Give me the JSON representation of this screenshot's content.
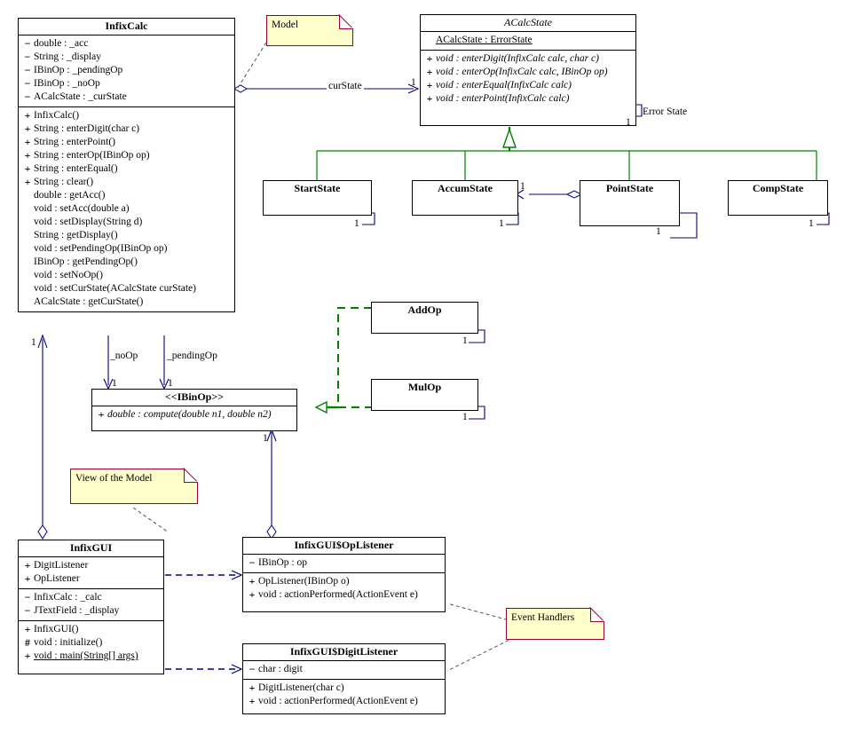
{
  "diagram": {
    "title": "InfixCalc UML class diagram",
    "colors": {
      "association": "#000080",
      "generalization": "#008000",
      "note_border": "#99003a",
      "note_fill": "#ffffcc",
      "box_border": "#000000",
      "background": "#ffffff"
    }
  },
  "classes": {
    "infixcalc": {
      "name": "InfixCalc",
      "fields": [
        {
          "vis": "−",
          "text": "double : _acc"
        },
        {
          "vis": "−",
          "text": "String : _display"
        },
        {
          "vis": "−",
          "text": "IBinOp : _pendingOp"
        },
        {
          "vis": "−",
          "text": "IBinOp : _noOp"
        },
        {
          "vis": "−",
          "text": "ACalcState : _curState"
        }
      ],
      "methods": [
        {
          "vis": "+",
          "text": "InfixCalc()"
        },
        {
          "vis": "+",
          "text": "String : enterDigit(char c)"
        },
        {
          "vis": "+",
          "text": "String : enterPoint()"
        },
        {
          "vis": "+",
          "text": "String : enterOp(IBinOp op)"
        },
        {
          "vis": "+",
          "text": "String : enterEqual()"
        },
        {
          "vis": "+",
          "text": "String : clear()"
        },
        {
          "vis": "",
          "text": "double : getAcc()"
        },
        {
          "vis": "",
          "text": "void : setAcc(double a)"
        },
        {
          "vis": "",
          "text": "void : setDisplay(String d)"
        },
        {
          "vis": "",
          "text": "String : getDisplay()"
        },
        {
          "vis": "",
          "text": "void : setPendingOp(IBinOp op)"
        },
        {
          "vis": "",
          "text": "IBinOp : getPendingOp()"
        },
        {
          "vis": "",
          "text": "void : setNoOp()"
        },
        {
          "vis": "",
          "text": "void : setCurState(ACalcState curState)"
        },
        {
          "vis": "",
          "text": "ACalcState : getCurState()"
        }
      ]
    },
    "acalcstate": {
      "name": "ACalcState",
      "abstract": true,
      "fields": [
        {
          "vis": "",
          "text": "ACalcState : ErrorState",
          "underline": true
        }
      ],
      "methods": [
        {
          "vis": "+",
          "text": "void : enterDigit(InfixCalc calc, char c)"
        },
        {
          "vis": "+",
          "text": "void : enterOp(InfixCalc calc, IBinOp op)"
        },
        {
          "vis": "+",
          "text": "void : enterEqual(InfixCalc calc)"
        },
        {
          "vis": "+",
          "text": "void : enterPoint(InfixCalc calc)"
        }
      ]
    },
    "startstate": {
      "name": "StartState",
      "mult": "1"
    },
    "accumstate": {
      "name": "AccumState",
      "mult": "1"
    },
    "pointstate": {
      "name": "PointState",
      "mult": "1"
    },
    "compstate": {
      "name": "CompState",
      "mult": "1"
    },
    "addop": {
      "name": "AddOp",
      "mult": "1"
    },
    "mulop": {
      "name": "MulOp",
      "mult": "1"
    },
    "ibinop": {
      "name": "<<IBinOp>>",
      "name_pre": "<<",
      "name_core": "IBinOp",
      "name_post": ">>",
      "methods": [
        {
          "vis": "+",
          "text": "double : compute(double n1, double n2)",
          "italic": true
        }
      ],
      "mult": "1"
    },
    "infixgui": {
      "name": "InfixGUI",
      "nested": [
        {
          "vis": "+",
          "text": "DigitListener"
        },
        {
          "vis": "+",
          "text": "OpListener"
        }
      ],
      "fields": [
        {
          "vis": "−",
          "text": "InfixCalc : _calc"
        },
        {
          "vis": "−",
          "text": "JTextField : _display"
        }
      ],
      "methods": [
        {
          "vis": "+",
          "text": "InfixGUI()"
        },
        {
          "vis": "#",
          "text": "void : initialize()"
        },
        {
          "vis": "+",
          "text": "void : main(String[] args)",
          "underline": true
        }
      ]
    },
    "oplistener": {
      "name": "InfixGUI$OpListener",
      "fields": [
        {
          "vis": "−",
          "text": "IBinOp : op"
        }
      ],
      "methods": [
        {
          "vis": "+",
          "text": "OpListener(IBinOp o)"
        },
        {
          "vis": "+",
          "text": "void : actionPerformed(ActionEvent e)"
        }
      ]
    },
    "digitlistener": {
      "name": "InfixGUI$DigitListener",
      "fields": [
        {
          "vis": "−",
          "text": "char : digit"
        }
      ],
      "methods": [
        {
          "vis": "+",
          "text": "DigitListener(char c)"
        },
        {
          "vis": "+",
          "text": "void : actionPerformed(ActionEvent e)"
        }
      ]
    }
  },
  "notes": [
    {
      "id": "model",
      "text": "Model"
    },
    {
      "id": "view",
      "text": "View of the Model"
    },
    {
      "id": "eventhandlers",
      "text": "Event Handlers"
    }
  ],
  "edge_labels": {
    "curstate": "curState",
    "noop": "_noOp",
    "pendingop": "_pendingOp",
    "errorstate": "Error State"
  },
  "multiplicities": {
    "acalcstate_curstate": "1",
    "acalcstate_error": "1",
    "infixcalc_left": "1",
    "ibinop_noop": "1",
    "ibinop_pendingop": "1",
    "ibinop_bottom": "1",
    "accumstate_assoc": "1"
  }
}
